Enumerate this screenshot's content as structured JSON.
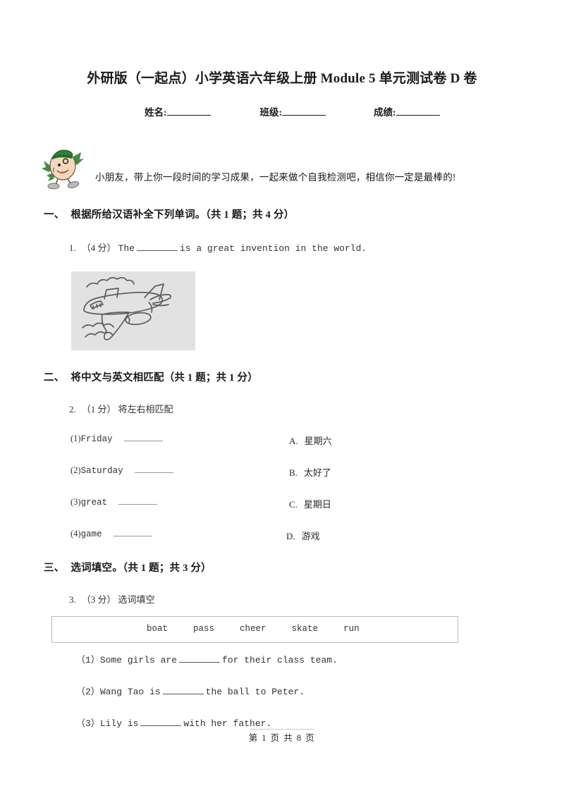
{
  "document": {
    "title": "外研版（一起点）小学英语六年级上册 Module 5 单元测试卷 D 卷",
    "info_fields": [
      {
        "label": "姓名:"
      },
      {
        "label": "班级:"
      },
      {
        "label": "成绩:"
      }
    ],
    "intro_text": "小朋友，带上你一段时间的学习成果，一起来做个自我检测吧，相信你一定是最棒的!",
    "mascot_icon": "egg-mascot-icon",
    "footer": "第 1 页 共 8 页"
  },
  "sections": [
    {
      "number": "一、",
      "title": "根据所给汉语补全下列单词。（共 1 题；共 4 分）"
    },
    {
      "number": "二、",
      "title": "将中文与英文相匹配（共 1 题；共 1 分）"
    },
    {
      "number": "三、",
      "title": "选词填空。（共 1 题；共 3 分）"
    }
  ],
  "questions": {
    "q1": {
      "number": "1.",
      "score": "（4 分）",
      "text_before": "The",
      "text_after": "is a great invention in the world.",
      "image_alt": "airplane-drawing"
    },
    "q2": {
      "number": "2.",
      "score": "（1 分）",
      "prompt": "将左右相匹配",
      "left_items": [
        {
          "index": "(1)",
          "word": "Friday"
        },
        {
          "index": "(2)",
          "word": "Saturday"
        },
        {
          "index": "(3)",
          "word": "great"
        },
        {
          "index": "(4)",
          "word": "game"
        }
      ],
      "right_items": [
        {
          "letter": "A.",
          "text": "星期六"
        },
        {
          "letter": "B.",
          "text": "太好了"
        },
        {
          "letter": "C.",
          "text": "星期日"
        },
        {
          "letter": "D.",
          "text": "游戏"
        }
      ]
    },
    "q3": {
      "number": "3.",
      "score": "（3 分）",
      "prompt": "选词填空",
      "word_bank": [
        "boat",
        "pass",
        "cheer",
        "skate",
        "run"
      ],
      "items": [
        {
          "index": "（1）",
          "before": "Some girls are",
          "after": "for their class team."
        },
        {
          "index": "（2）",
          "before": "Wang Tao is",
          "after": "the ball to Peter."
        },
        {
          "index": "（3）",
          "before": "Lily is",
          "after": "with her father."
        }
      ]
    }
  },
  "colors": {
    "image_bg": "#e2e2e2",
    "border": "#bcbcbc",
    "text": "#1a1a1a"
  }
}
